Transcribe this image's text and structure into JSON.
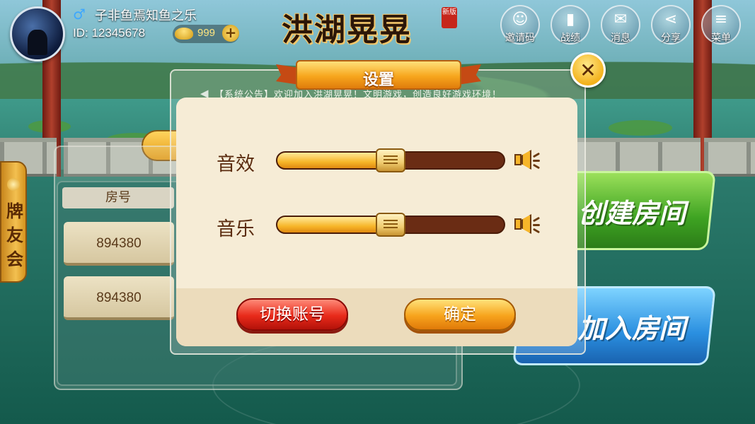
{
  "user": {
    "nickname": "子非鱼焉知鱼之乐",
    "id_text": "ID: 12345678",
    "gold": "999",
    "gender_icon": "male-symbol-icon"
  },
  "logo": {
    "title": "洪湖晃晃",
    "badge": "新版"
  },
  "top_menu": [
    {
      "label": "邀请码",
      "icon": "invite-user-icon"
    },
    {
      "label": "战绩",
      "icon": "bar-chart-icon"
    },
    {
      "label": "消息",
      "icon": "envelope-icon"
    },
    {
      "label": "分享",
      "icon": "share-icon"
    },
    {
      "label": "菜单",
      "icon": "menu-icon"
    }
  ],
  "side_tab": {
    "label": "牌友会"
  },
  "room_list": {
    "header": "房号",
    "rows": [
      "894380",
      "894380"
    ]
  },
  "main_buttons": {
    "create": "创建房间",
    "join": "加入房间"
  },
  "announcement": "【系统公告】欢迎加入洪湖晃晃！文明游戏，创造良好游戏环境！",
  "settings_dialog": {
    "title": "设置",
    "sound_effect": {
      "label": "音效",
      "level": 0.5
    },
    "music": {
      "label": "音乐",
      "level": 0.5
    },
    "switch_account": "切换账号",
    "confirm": "确定"
  },
  "colors": {
    "accent_gold": "#f7a61d",
    "brand_red": "#e82a1a",
    "panel_cream": "#f6ecd6",
    "slider_track": "#6a2c14"
  }
}
